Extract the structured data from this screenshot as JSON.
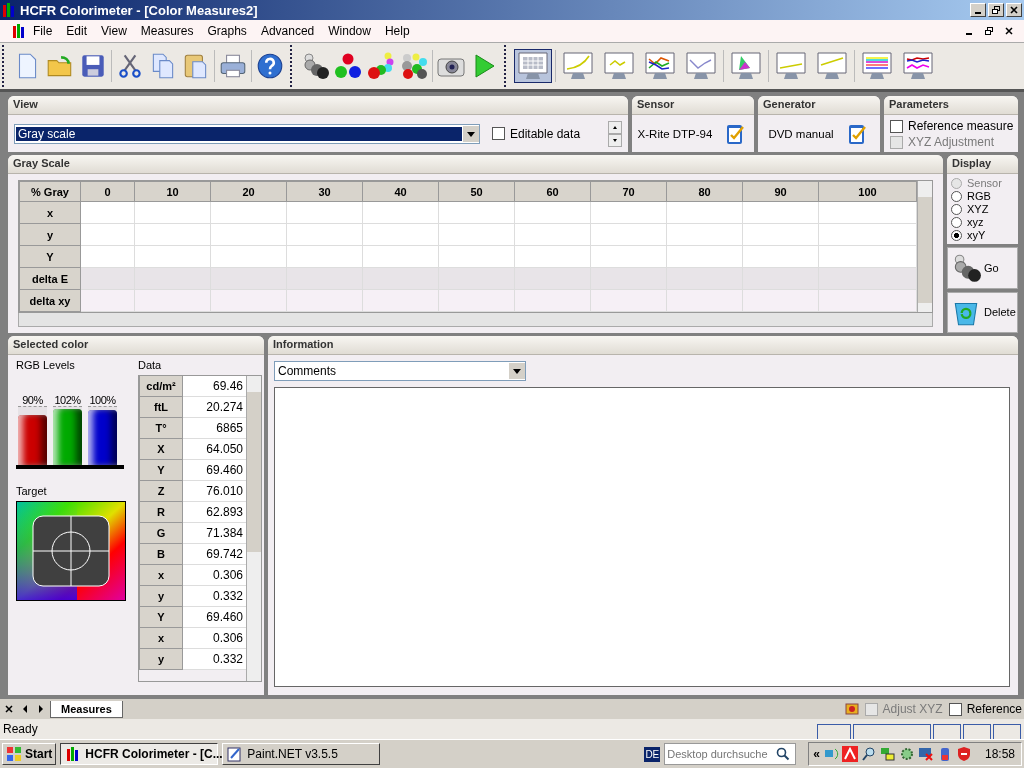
{
  "window": {
    "title": "HCFR Colorimeter - [Color Measures2]"
  },
  "menu": [
    "File",
    "Edit",
    "View",
    "Measures",
    "Graphs",
    "Advanced",
    "Window",
    "Help"
  ],
  "view_buttons": [
    {
      "kind": "grid",
      "selected": true
    },
    {
      "kind": "rising-curve",
      "selected": false
    },
    {
      "kind": "wave",
      "selected": false
    },
    {
      "kind": "rgb-lines",
      "selected": false
    },
    {
      "kind": "dip-line",
      "selected": false
    },
    {
      "kind": "gamut",
      "selected": false
    },
    {
      "kind": "flat-line",
      "selected": false
    },
    {
      "kind": "slope-line",
      "selected": false
    },
    {
      "kind": "stripes",
      "selected": false
    },
    {
      "kind": "multi-wave",
      "selected": false
    }
  ],
  "view": {
    "title": "View",
    "dropdown": "Gray scale",
    "editable_data": {
      "label": "Editable data",
      "checked": false
    }
  },
  "sensor": {
    "title": "Sensor",
    "name": "X-Rite DTP-94"
  },
  "generator": {
    "title": "Generator",
    "name": "DVD manual"
  },
  "parameters": {
    "title": "Parameters",
    "options": [
      {
        "label": "Reference measure",
        "checked": false,
        "disabled": false
      },
      {
        "label": "XYZ Adjustment",
        "checked": false,
        "disabled": true
      }
    ]
  },
  "gray_scale": {
    "title": "Gray Scale",
    "columns": [
      "% Gray",
      "0",
      "10",
      "20",
      "30",
      "40",
      "50",
      "60",
      "70",
      "80",
      "90",
      "100"
    ],
    "rows": [
      "x",
      "y",
      "Y",
      "delta E",
      "delta xy"
    ]
  },
  "display": {
    "title": "Display",
    "options": [
      {
        "label": "Sensor",
        "selected": false,
        "disabled": true
      },
      {
        "label": "RGB",
        "selected": false,
        "disabled": false
      },
      {
        "label": "XYZ",
        "selected": false,
        "disabled": false
      },
      {
        "label": "xyz",
        "selected": false,
        "disabled": false
      },
      {
        "label": "xyY",
        "selected": true,
        "disabled": false
      }
    ],
    "go": "Go",
    "delete": "Delete"
  },
  "selected_color": {
    "title": "Selected color",
    "rgb_title": "RGB Levels",
    "bars": [
      {
        "reading": "90%",
        "level": 0.86,
        "color": "#cc0000"
      },
      {
        "reading": "102%",
        "level": 0.97,
        "color": "#00aa00"
      },
      {
        "reading": "100%",
        "level": 0.95,
        "color": "#0000cc"
      }
    ],
    "target_title": "Target",
    "data_title": "Data",
    "data": [
      {
        "label": "cd/m²",
        "value": "69.46"
      },
      {
        "label": "ftL",
        "value": "20.274"
      },
      {
        "label": "T°",
        "value": "6865"
      },
      {
        "label": "X",
        "value": "64.050"
      },
      {
        "label": "Y",
        "value": "69.460"
      },
      {
        "label": "Z",
        "value": "76.010"
      },
      {
        "label": "R",
        "value": "62.893"
      },
      {
        "label": "G",
        "value": "71.384"
      },
      {
        "label": "B",
        "value": "69.742"
      },
      {
        "label": "x",
        "value": "0.306"
      },
      {
        "label": "y",
        "value": "0.332"
      },
      {
        "label": "Y",
        "value": "69.460"
      },
      {
        "label": "x",
        "value": "0.306"
      },
      {
        "label": "y",
        "value": "0.332"
      }
    ]
  },
  "information": {
    "title": "Information",
    "dropdown": "Comments"
  },
  "tabs": [
    {
      "label": "Measures",
      "selected": true
    }
  ],
  "footer_options": [
    {
      "label": "Adjust XYZ",
      "checked": false,
      "disabled": true
    },
    {
      "label": "Reference",
      "checked": false,
      "disabled": false
    }
  ],
  "status_bar": {
    "text": "Ready"
  },
  "taskbar": {
    "start": "Start",
    "tasks": [
      {
        "label": "HCFR Colorimeter - [C...",
        "selected": true
      },
      {
        "label": "Paint.NET v3.5.5",
        "selected": false
      }
    ],
    "language": "DE",
    "search_placeholder": "Desktop durchsuche",
    "clock": "18:58",
    "tray_toggle": "«"
  }
}
